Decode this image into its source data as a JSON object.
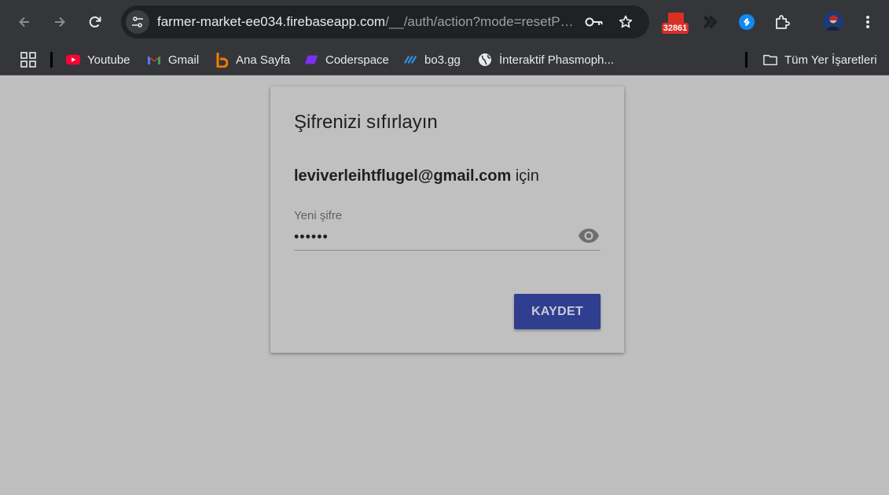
{
  "browser": {
    "url_host": "farmer-market-ee034.firebaseapp.com",
    "url_path": "/__/auth/action?mode=resetPassword&oobCode",
    "mail_badge_count": "32861"
  },
  "bookmarks": [
    {
      "label": "Youtube"
    },
    {
      "label": "Gmail"
    },
    {
      "label": "Ana Sayfa"
    },
    {
      "label": "Coderspace"
    },
    {
      "label": "bo3.gg"
    },
    {
      "label": "İnteraktif Phasmoph..."
    }
  ],
  "all_bookmarks_label": "Tüm Yer İşaretleri",
  "card": {
    "title": "Şifrenizi sıfırlayın",
    "email": "leviverleihtflugel@gmail.com",
    "for_suffix": " için",
    "password_label": "Yeni şifre",
    "password_value": "••••••",
    "save_label": "KAYDET"
  },
  "colors": {
    "primary_button": "#2f3e8f",
    "page_background": "#bfbfbf",
    "toolbar": "#35363a"
  }
}
